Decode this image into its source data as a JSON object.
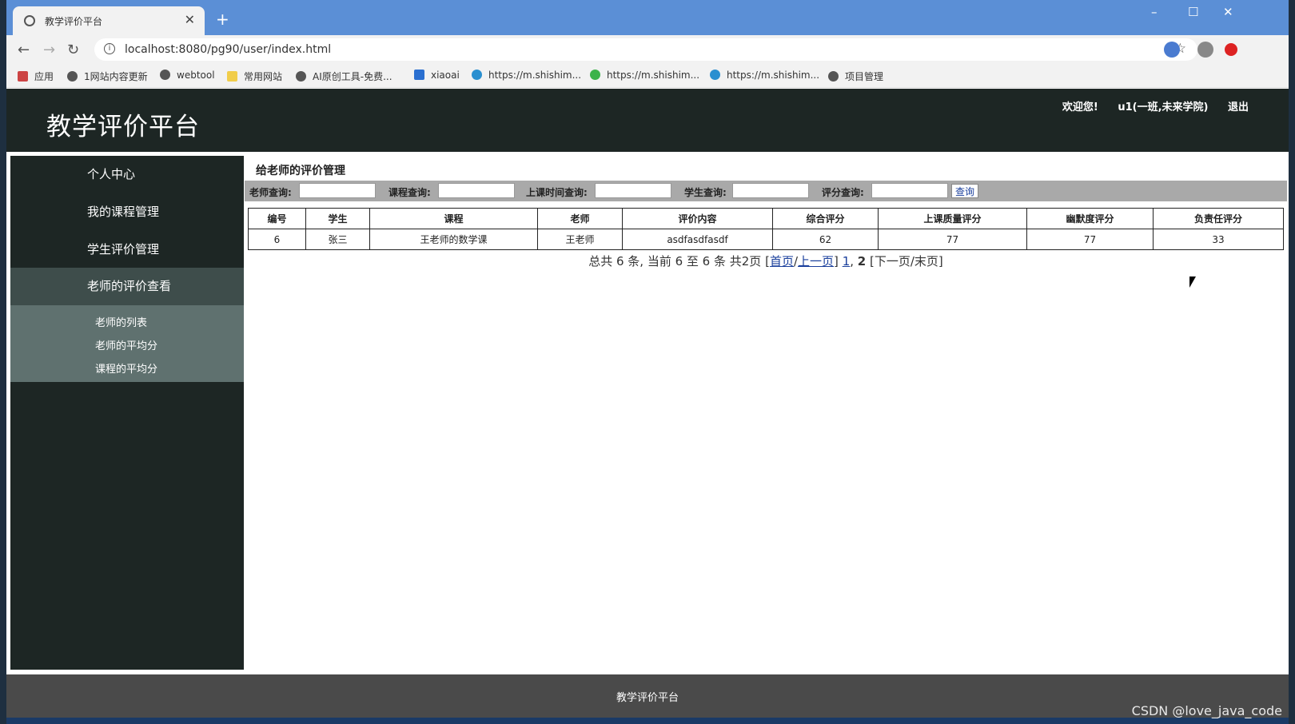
{
  "browser": {
    "tab_title": "教学评价平台",
    "url": "localhost:8080/pg90/user/index.html",
    "new_tab_symbol": "+",
    "bookmarks": [
      {
        "label": "应用"
      },
      {
        "label": "1网站内容更新"
      },
      {
        "label": "webtool"
      },
      {
        "label": "常用网站"
      },
      {
        "label": "AI原创工具-免费..."
      },
      {
        "label": "xiaoai"
      },
      {
        "label": "https://m.shishim..."
      },
      {
        "label": "https://m.shishim..."
      },
      {
        "label": "https://m.shishim..."
      },
      {
        "label": "项目管理"
      }
    ]
  },
  "header": {
    "site_title": "教学评价平台",
    "welcome": "欢迎您!",
    "user": "u1(一班,未来学院)",
    "logout": "退出"
  },
  "sidebar": {
    "items": [
      {
        "label": "个人中心"
      },
      {
        "label": "我的课程管理"
      },
      {
        "label": "学生评价管理"
      },
      {
        "label": "老师的评价查看"
      }
    ],
    "subitems": [
      {
        "label": "老师的列表"
      },
      {
        "label": "老师的平均分"
      },
      {
        "label": "课程的平均分"
      }
    ]
  },
  "main": {
    "section_title": "给老师的评价管理",
    "search": {
      "teacher_label": "老师查询:",
      "course_label": "课程查询:",
      "time_label": "上课时间查询:",
      "student_label": "学生查询:",
      "score_label": "评分查询:",
      "button": "查询"
    },
    "table": {
      "headers": [
        "编号",
        "学生",
        "课程",
        "老师",
        "评价内容",
        "综合评分",
        "上课质量评分",
        "幽默度评分",
        "负责任评分"
      ],
      "rows": [
        [
          "6",
          "张三",
          "王老师的数学课",
          "王老师",
          "asdfasdfasdf",
          "62",
          "77",
          "77",
          "33"
        ]
      ]
    },
    "pager": {
      "summary": "总共 6 条, 当前 6 至 6 条 共2页",
      "first": "首页",
      "prev": "上一页",
      "page1": "1",
      "page2": "2",
      "next_last": "[下一页/末页]"
    }
  },
  "footer": {
    "text": "教学评价平台",
    "watermark": "CSDN @love_java_code"
  },
  "colors": {
    "header_bg": "#1d2624",
    "sidebar_bg": "#1d2624",
    "submenu_bg": "#5f716f",
    "tabstrip_bg": "#5b8fd6",
    "link": "#1a3f9c"
  }
}
